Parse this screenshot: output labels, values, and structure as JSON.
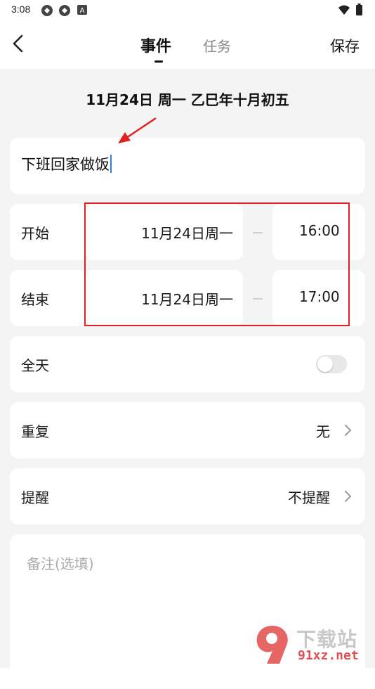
{
  "status_bar": {
    "time": "3:08",
    "icons": [
      "app-icon-1",
      "app-icon-2",
      "notification-a-icon"
    ],
    "right_icons": [
      "wifi-icon",
      "battery-icon"
    ]
  },
  "header": {
    "tab_event": "事件",
    "tab_task": "任务",
    "save": "保存"
  },
  "date_title": "11月24日 周一 乙巳年十月初五",
  "event_title": "下班回家做饭",
  "start": {
    "label": "开始",
    "date": "11月24日周一",
    "time": "16:00"
  },
  "end": {
    "label": "结束",
    "date": "11月24日周一",
    "time": "17:00"
  },
  "all_day": {
    "label": "全天",
    "enabled": false
  },
  "repeat": {
    "label": "重复",
    "value": "无"
  },
  "reminder": {
    "label": "提醒",
    "value": "不提醒"
  },
  "note": {
    "placeholder": "备注(选填)"
  },
  "colors": {
    "annotation_red": "#e02020",
    "cursor_blue": "#2b7cff",
    "background": "#f4f4f4"
  },
  "watermark": {
    "name": "下载站",
    "url": "91xz.net"
  }
}
